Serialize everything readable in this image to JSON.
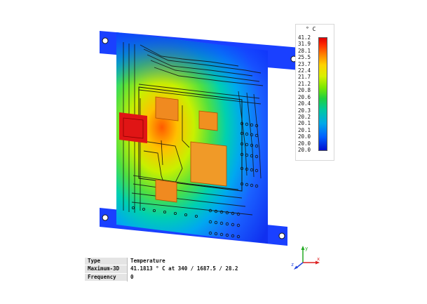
{
  "legend": {
    "unit": "° C",
    "ticks": [
      "41.2",
      "31.9",
      "28.1",
      "25.5",
      "23.7",
      "22.4",
      "21.7",
      "21.2",
      "20.8",
      "20.6",
      "20.4",
      "20.3",
      "20.2",
      "20.1",
      "20.1",
      "20.0",
      "20.0",
      "20.0"
    ]
  },
  "info": {
    "rows": [
      {
        "key": "Type",
        "value": "Temperature"
      },
      {
        "key": "Maximum-3D",
        "value": "41.1813 ° C at 340 / 1687.5 / 28.2"
      },
      {
        "key": "Frequency",
        "value": "0"
      }
    ]
  },
  "axes": {
    "x": "x",
    "y": "y",
    "z": "z"
  },
  "colors": {
    "hot": "#e01010",
    "warm": "#f08a20",
    "cool": "#1a48ff",
    "trace": "#111111"
  }
}
